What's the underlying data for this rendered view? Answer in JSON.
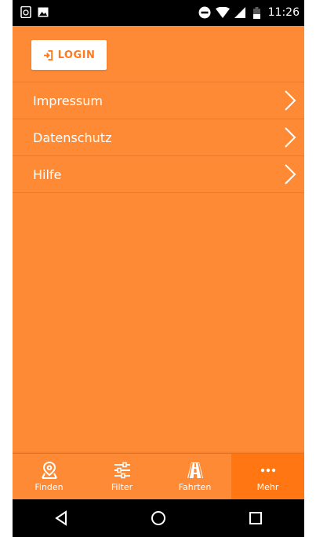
{
  "status_bar": {
    "time": "11:26",
    "left_icons": [
      "phone-sync-icon",
      "image-icon"
    ],
    "right_icons": [
      "do-not-disturb-icon",
      "wifi-icon",
      "signal-icon",
      "battery-icon"
    ]
  },
  "login": {
    "label": "LOGIN",
    "icon": "login-arrow-icon"
  },
  "menu": {
    "items": [
      {
        "label": "Impressum",
        "icon": "chevron-right-icon"
      },
      {
        "label": "Datenschutz",
        "icon": "chevron-right-icon"
      },
      {
        "label": "Hilfe",
        "icon": "chevron-right-icon"
      }
    ]
  },
  "bottom_nav": {
    "items": [
      {
        "label": "Finden",
        "icon": "map-pin-icon"
      },
      {
        "label": "Filter",
        "icon": "sliders-icon"
      },
      {
        "label": "Fahrten",
        "icon": "road-icon"
      },
      {
        "label": "Mehr",
        "icon": "more-dots-icon",
        "active": true
      }
    ]
  },
  "system_nav": [
    "back-icon",
    "home-icon",
    "recents-icon"
  ],
  "colors": {
    "primary": "#ff8a35",
    "active_tab": "#ff7613",
    "login_text": "#ff7a1e"
  }
}
